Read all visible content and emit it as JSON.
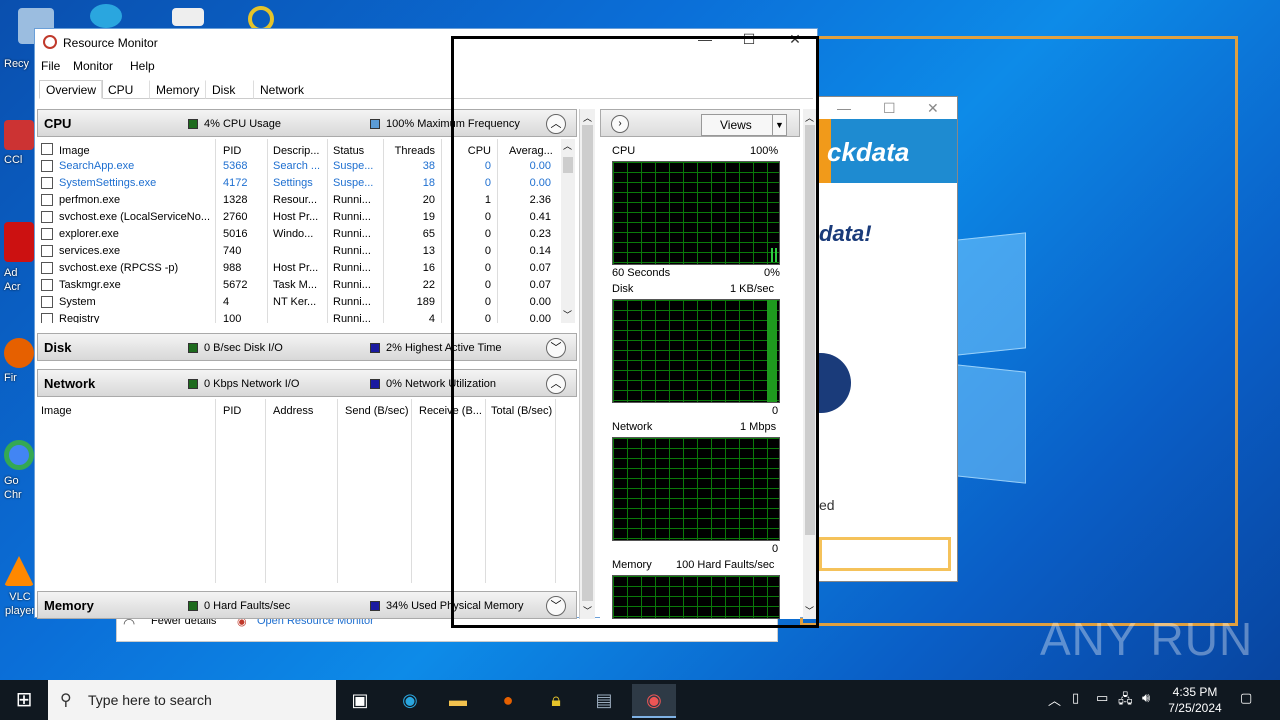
{
  "desktop": {
    "icons": [
      {
        "label": "Recy",
        "color": "#9bbde0"
      },
      {
        "label": "CCl",
        "color": "#c33"
      },
      {
        "label": "Ad\nAcr",
        "color": "#c11"
      },
      {
        "label": "Fir",
        "color": "#e66000"
      },
      {
        "label": "Go\nChr",
        "color": "#4285f4"
      },
      {
        "label": "VLC\nplayer",
        "color": "#f80"
      }
    ],
    "watermark": "ANY RUN"
  },
  "bgapp": {
    "brand": "ckdata",
    "headline": "data!",
    "text": "ed"
  },
  "window": {
    "title": "Resource Monitor",
    "minimize": "—",
    "maximize": "☐",
    "close": "✕",
    "menu": [
      "File",
      "Monitor",
      "Help"
    ],
    "tabs": [
      "Overview",
      "CPU",
      "Memory",
      "Disk",
      "Network"
    ],
    "active_tab": "Overview"
  },
  "cpu_section": {
    "name": "CPU",
    "usage": "4% CPU Usage",
    "usage_color": "#1e6b1e",
    "frequency": "100% Maximum Frequency",
    "frequency_color": "#5b9bd5",
    "columns": [
      "Image",
      "PID",
      "Descrip...",
      "Status",
      "Threads",
      "CPU",
      "Averag..."
    ],
    "rows": [
      {
        "image": "SearchApp.exe",
        "pid": "5368",
        "desc": "Search ...",
        "status": "Suspe...",
        "threads": "38",
        "cpu": "0",
        "avg": "0.00",
        "suspended": true
      },
      {
        "image": "SystemSettings.exe",
        "pid": "4172",
        "desc": "Settings",
        "status": "Suspe...",
        "threads": "18",
        "cpu": "0",
        "avg": "0.00",
        "suspended": true
      },
      {
        "image": "perfmon.exe",
        "pid": "1328",
        "desc": "Resour...",
        "status": "Runni...",
        "threads": "20",
        "cpu": "1",
        "avg": "2.36",
        "suspended": false
      },
      {
        "image": "svchost.exe (LocalServiceNo...",
        "pid": "2760",
        "desc": "Host Pr...",
        "status": "Runni...",
        "threads": "19",
        "cpu": "0",
        "avg": "0.41",
        "suspended": false
      },
      {
        "image": "explorer.exe",
        "pid": "5016",
        "desc": "Windo...",
        "status": "Runni...",
        "threads": "65",
        "cpu": "0",
        "avg": "0.23",
        "suspended": false
      },
      {
        "image": "services.exe",
        "pid": "740",
        "desc": "",
        "status": "Runni...",
        "threads": "13",
        "cpu": "0",
        "avg": "0.14",
        "suspended": false
      },
      {
        "image": "svchost.exe (RPCSS -p)",
        "pid": "988",
        "desc": "Host Pr...",
        "status": "Runni...",
        "threads": "16",
        "cpu": "0",
        "avg": "0.07",
        "suspended": false
      },
      {
        "image": "Taskmgr.exe",
        "pid": "5672",
        "desc": "Task M...",
        "status": "Runni...",
        "threads": "22",
        "cpu": "0",
        "avg": "0.07",
        "suspended": false
      },
      {
        "image": "System",
        "pid": "4",
        "desc": "NT Ker...",
        "status": "Runni...",
        "threads": "189",
        "cpu": "0",
        "avg": "0.00",
        "suspended": false
      },
      {
        "image": "Registry",
        "pid": "100",
        "desc": "",
        "status": "Runni...",
        "threads": "4",
        "cpu": "0",
        "avg": "0.00",
        "suspended": false
      }
    ]
  },
  "disk_section": {
    "name": "Disk",
    "io": "0 B/sec Disk I/O",
    "io_color": "#1e6b1e",
    "active": "2% Highest Active Time",
    "active_color": "#1a1aa0"
  },
  "network_section": {
    "name": "Network",
    "io": "0 Kbps Network I/O",
    "io_color": "#1e6b1e",
    "util": "0% Network Utilization",
    "util_color": "#1a1aa0",
    "columns": [
      "Image",
      "PID",
      "Address",
      "Send (B/sec)",
      "Receive (B...",
      "Total (B/sec)"
    ]
  },
  "memory_section": {
    "name": "Memory",
    "faults": "0 Hard Faults/sec",
    "faults_color": "#1e6b1e",
    "used": "34% Used Physical Memory",
    "used_color": "#1a1aa0"
  },
  "graphs": {
    "views_label": "Views",
    "cpu": {
      "label": "CPU",
      "max": "100%",
      "footer_left": "60 Seconds",
      "footer_right": "0%"
    },
    "disk": {
      "label": "Disk",
      "max": "1 KB/sec",
      "footer_right": "0"
    },
    "network": {
      "label": "Network",
      "max": "1 Mbps",
      "footer_right": "0"
    },
    "memory": {
      "label": "Memory",
      "max": "100 Hard Faults/sec"
    }
  },
  "behind_window": {
    "fewer_details": "Fewer details",
    "open_rm": "Open Resource Monitor"
  },
  "taskbar": {
    "search_placeholder": "Type here to search",
    "time": "4:35 PM",
    "date": "7/25/2024"
  }
}
